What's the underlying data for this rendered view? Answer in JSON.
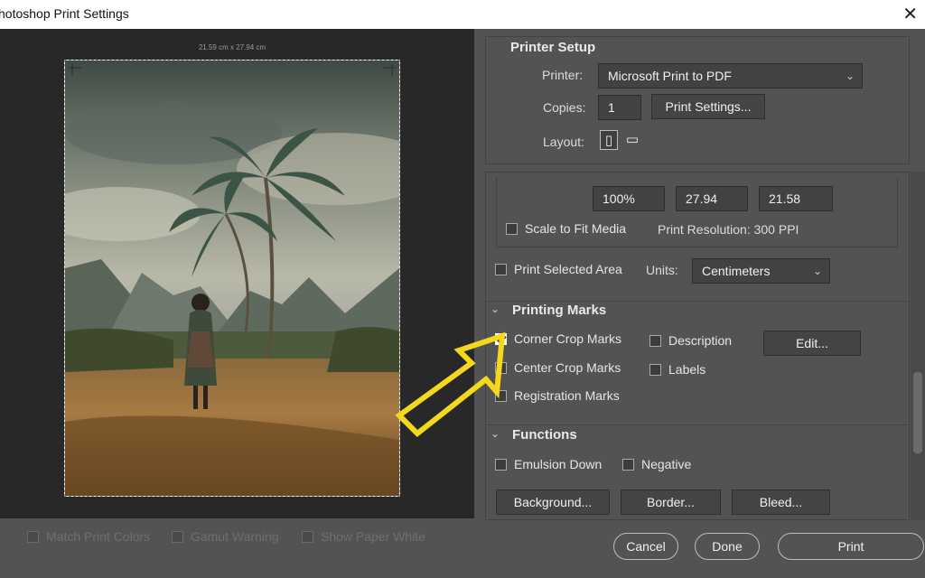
{
  "window": {
    "title": "hotoshop Print Settings",
    "close_glyph": "✕"
  },
  "preview": {
    "paper_size": "21.59 cm x 27.94 cm"
  },
  "color_checks": [
    {
      "label": "Match Print Colors",
      "checked": false
    },
    {
      "label": "Gamut Warning",
      "checked": false
    },
    {
      "label": "Show Paper White",
      "checked": false
    }
  ],
  "printer_setup": {
    "heading": "Printer Setup",
    "printer_label": "Printer:",
    "printer_value": "Microsoft Print to PDF",
    "copies_label": "Copies:",
    "copies_value": "1",
    "print_settings_button": "Print Settings...",
    "layout_label": "Layout:",
    "layout_options": [
      "portrait-icon",
      "landscape-icon"
    ]
  },
  "position_size": {
    "scale": "100%",
    "height": "27.94",
    "width": "21.58",
    "scale_to_fit_label": "Scale to Fit Media",
    "print_resolution": "Print Resolution: 300 PPI",
    "print_selected_label": "Print Selected Area",
    "units_label": "Units:",
    "units_value": "Centimeters"
  },
  "printing_marks": {
    "heading": "Printing Marks",
    "corner_crop": {
      "label": "Corner Crop Marks",
      "checked": true
    },
    "center_crop": {
      "label": "Center Crop Marks",
      "checked": false
    },
    "registration": {
      "label": "Registration Marks",
      "checked": false
    },
    "description": {
      "label": "Description",
      "checked": false
    },
    "labels": {
      "label": "Labels",
      "checked": false
    },
    "edit_button": "Edit..."
  },
  "functions": {
    "heading": "Functions",
    "emulsion_down": {
      "label": "Emulsion Down",
      "checked": false
    },
    "negative": {
      "label": "Negative",
      "checked": false
    },
    "background_button": "Background...",
    "border_button": "Border...",
    "bleed_button": "Bleed..."
  },
  "footer": {
    "cancel": "Cancel",
    "done": "Done",
    "print": "Print"
  },
  "colors": {
    "callout_arrow": "#f4d81e",
    "dialog_bg": "#535353",
    "preview_bg": "#282828"
  }
}
